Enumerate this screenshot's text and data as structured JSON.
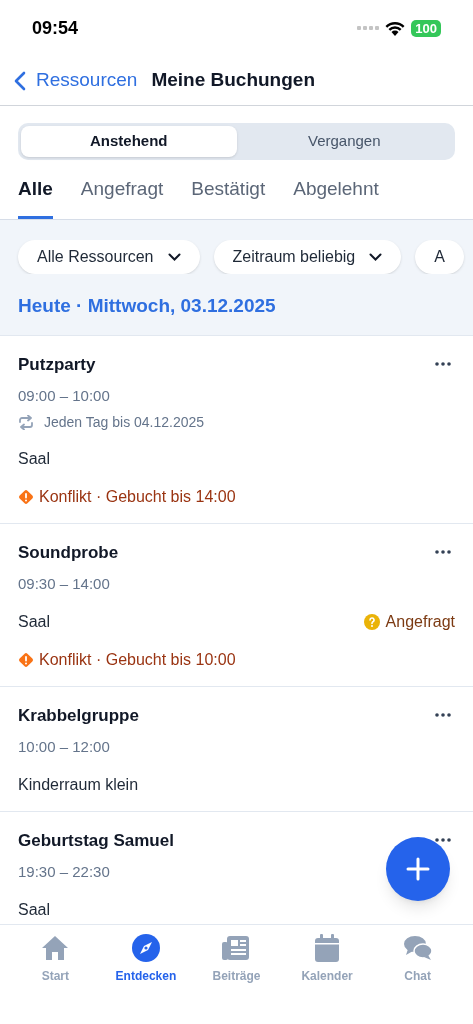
{
  "status_bar": {
    "time": "09:54",
    "battery": "100"
  },
  "nav": {
    "back": "Ressourcen",
    "title": "Meine Buchungen"
  },
  "segments": [
    {
      "label": "Anstehend",
      "selected": true
    },
    {
      "label": "Vergangen",
      "selected": false
    }
  ],
  "tabs": [
    {
      "label": "Alle",
      "selected": true
    },
    {
      "label": "Angefragt",
      "selected": false
    },
    {
      "label": "Bestätigt",
      "selected": false
    },
    {
      "label": "Abgelehnt",
      "selected": false
    }
  ],
  "filters": [
    {
      "label": "Alle Ressourcen",
      "dropdown": true
    },
    {
      "label": "Zeitraum beliebig",
      "dropdown": true
    },
    {
      "label": "A",
      "dropdown": false
    }
  ],
  "date_heading": "Heute · Mittwoch, 03.12.2025",
  "bookings": [
    {
      "title": "Putzparty",
      "time": "09:00 – 10:00",
      "recurrence": "Jeden Tag bis 04.12.2025",
      "room": "Saal",
      "conflict": "Konflikt · Gebucht bis 14:00"
    },
    {
      "title": "Soundprobe",
      "time": "09:30 – 14:00",
      "room": "Saal",
      "status": "Angefragt",
      "conflict": "Konflikt · Gebucht bis 10:00"
    },
    {
      "title": "Krabbelgruppe",
      "time": "10:00 – 12:00",
      "room": "Kinderraum klein"
    },
    {
      "title": "Geburtstag Samuel",
      "time": "19:30 – 22:30",
      "room": "Saal"
    }
  ],
  "tab_bar": [
    {
      "label": "Start",
      "kind": "home",
      "selected": false
    },
    {
      "label": "Entdecken",
      "kind": "compass",
      "selected": true
    },
    {
      "label": "Beiträge",
      "kind": "news",
      "selected": false
    },
    {
      "label": "Kalender",
      "kind": "calendar",
      "selected": false
    },
    {
      "label": "Chat",
      "kind": "chat",
      "selected": false
    }
  ]
}
